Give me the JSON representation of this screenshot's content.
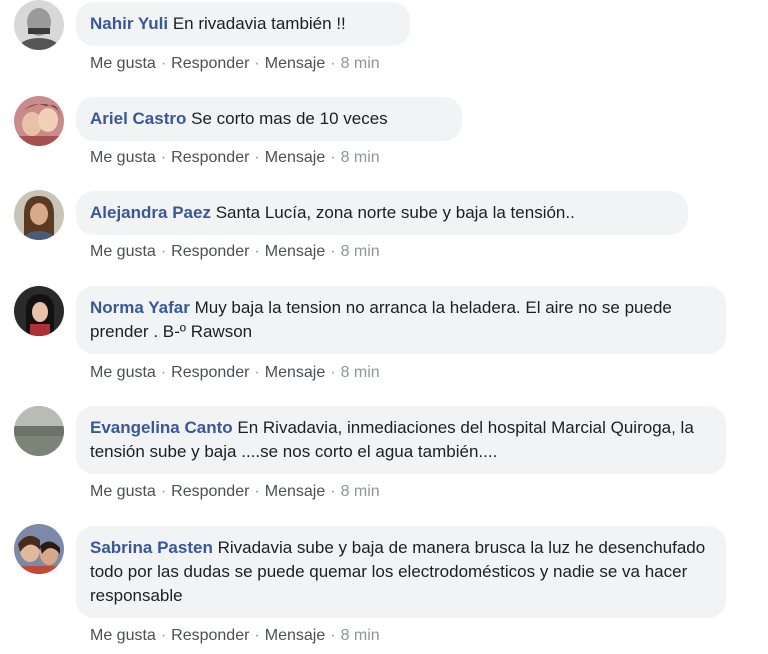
{
  "comments": [
    {
      "author": "Nahir Yuli",
      "text": "En rivadavia también !!",
      "actions": {
        "like": "Me gusta",
        "reply": "Responder",
        "message": "Mensaje",
        "time": "8 min"
      }
    },
    {
      "author": "Ariel Castro",
      "text": "Se corto mas de 10 veces",
      "actions": {
        "like": "Me gusta",
        "reply": "Responder",
        "message": "Mensaje",
        "time": "8 min"
      }
    },
    {
      "author": "Alejandra Paez",
      "text": "Santa Lucía, zona norte sube y baja la tensión..",
      "actions": {
        "like": "Me gusta",
        "reply": "Responder",
        "message": "Mensaje",
        "time": "8 min"
      }
    },
    {
      "author": "Norma Yafar",
      "text": "Muy baja la tension no arranca la heladera. El aire no se puede prender . B-º Rawson",
      "actions": {
        "like": "Me gusta",
        "reply": "Responder",
        "message": "Mensaje",
        "time": "8 min"
      }
    },
    {
      "author": "Evangelina Canto",
      "text": "En Rivadavia, inmediaciones del hospital Marcial Quiroga, la tensión sube y baja ....se nos corto el agua también....",
      "actions": {
        "like": "Me gusta",
        "reply": "Responder",
        "message": "Mensaje",
        "time": "8 min"
      }
    },
    {
      "author": "Sabrina Pasten",
      "text": "Rivadavia sube y baja de manera brusca la luz he desenchufado todo por las dudas se puede quemar los electrodomésticos y nadie se va hacer responsable",
      "actions": {
        "like": "Me gusta",
        "reply": "Responder",
        "message": "Mensaje",
        "time": "8 min"
      }
    }
  ],
  "separator": "·"
}
